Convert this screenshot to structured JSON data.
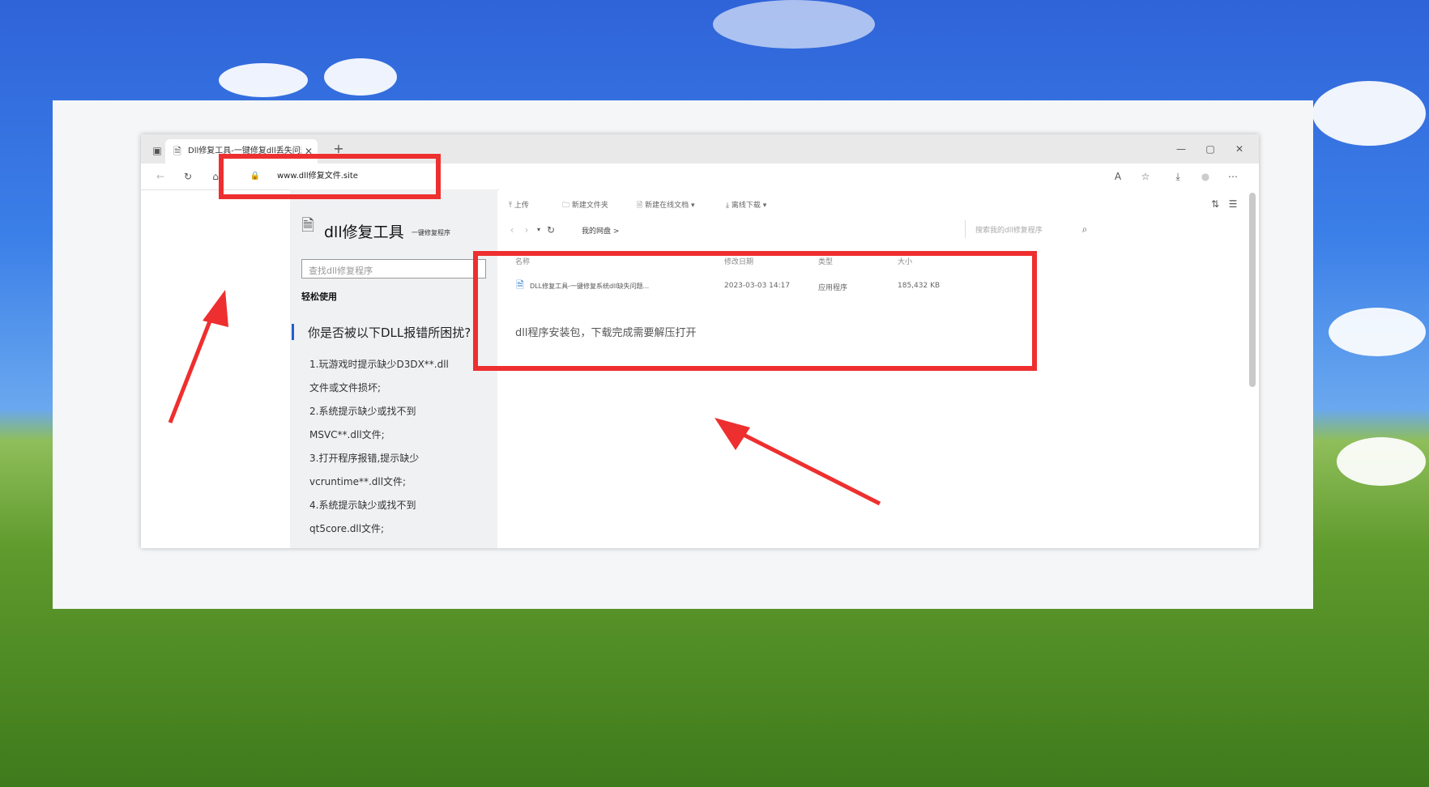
{
  "browser": {
    "tab_title": "Dll修复工具-一键修复dll丢失问题",
    "url": "www.dll修复文件.site",
    "new_tab": "+",
    "window_controls": [
      "—",
      "▢",
      "✕"
    ]
  },
  "sidebar": {
    "brand": "dll修复工具",
    "brand_sub": "一键修复程序",
    "search_placeholder": "查找dll修复程序",
    "easy_use": "轻松使用",
    "question": "你是否被以下DLL报错所困扰?",
    "items": [
      "1.玩游戏时提示缺少D3DX**.dll",
      "文件或文件损坏;",
      "2.系统提示缺少或找不到",
      "MSVC**.dll文件;",
      "3.打开程序报错,提示缺少",
      "vcruntime**.dll文件;",
      "4.系统提示缺少或找不到",
      "qt5core.dll文件;"
    ]
  },
  "drive": {
    "toolbar": {
      "upload": "上传",
      "new_folder": "新建文件夹",
      "new_doc": "新建在线文档",
      "offline_download": "离线下载"
    },
    "breadcrumb": "我的网盘",
    "search_placeholder": "搜索我的dll修复程序",
    "columns": [
      "名称",
      "修改日期",
      "类型",
      "大小"
    ],
    "file": {
      "name": "DLL修复工具-一键修复系统dll缺失问题...",
      "date": "2023-03-03 14:17",
      "type": "应用程序",
      "size": "185,432 KB"
    },
    "note": "dll程序安装包，下载完成需要解压打开"
  },
  "colors": {
    "highlight": "#ee2f2f",
    "arrow": "#ee2f2f"
  }
}
